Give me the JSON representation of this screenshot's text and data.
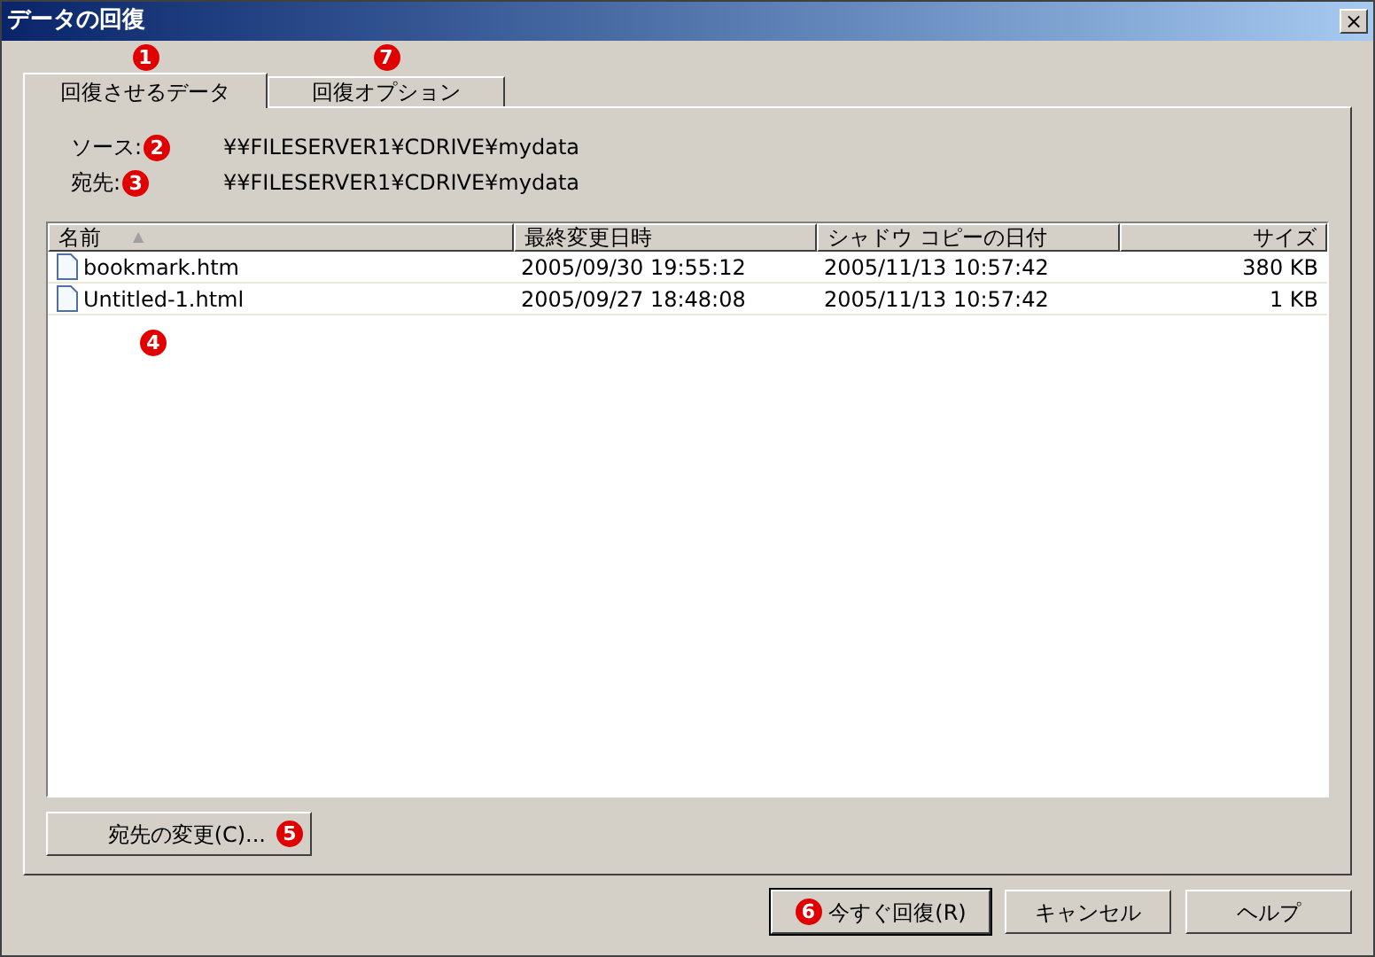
{
  "window": {
    "title": "データの回復",
    "close": "×"
  },
  "tabs": [
    {
      "label": "回復させるデータ",
      "selected": true,
      "callout": "1"
    },
    {
      "label": "回復オプション",
      "selected": false,
      "callout": "7"
    }
  ],
  "fields": [
    {
      "label": "ソース:",
      "callout": "2",
      "value": "¥¥FILESERVER1¥CDRIVE¥mydata"
    },
    {
      "label": "宛先:",
      "callout": "3",
      "value": "¥¥FILESERVER1¥CDRIVE¥mydata"
    }
  ],
  "table": {
    "columns": [
      {
        "label": "名前",
        "sort": "▲"
      },
      {
        "label": "最終変更日時"
      },
      {
        "label": "シャドウ コピーの日付"
      },
      {
        "label": "サイズ"
      }
    ],
    "rows": [
      {
        "name": "bookmark.htm",
        "modified": "2005/09/30 19:55:12",
        "shadow": "2005/11/13 10:57:42",
        "size": "380 KB"
      },
      {
        "name": "Untitled-1.html",
        "modified": "2005/09/27 18:48:08",
        "shadow": "2005/11/13 10:57:42",
        "size": "1 KB"
      }
    ],
    "callout": "4"
  },
  "change_button": {
    "label": "宛先の変更(C)...",
    "callout": "5"
  },
  "buttons": [
    {
      "label": "今すぐ回復(R)",
      "callout": "6",
      "default": true
    },
    {
      "label": "キャンセル",
      "default": false
    },
    {
      "label": "ヘルプ",
      "default": false
    }
  ]
}
